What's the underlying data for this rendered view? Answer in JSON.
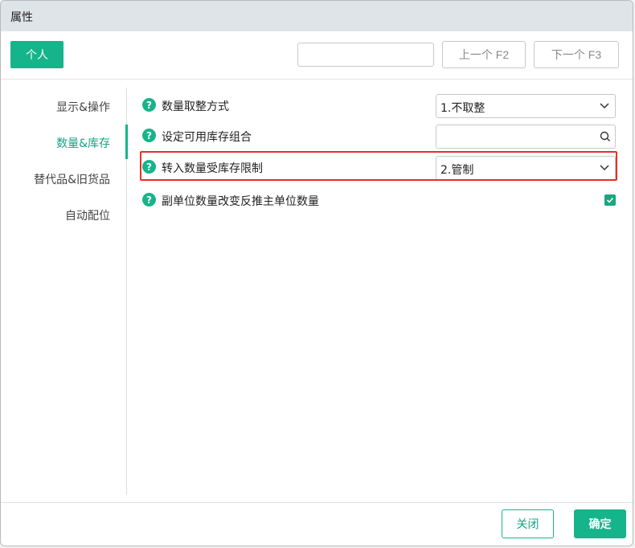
{
  "window": {
    "title": "属性"
  },
  "toolbar": {
    "tab_label": "个人",
    "search": {
      "value": "",
      "placeholder": ""
    },
    "prev_label": "上一个 F2",
    "next_label": "下一个 F3"
  },
  "sidebar": {
    "items": [
      {
        "label": "显示&操作",
        "active": false
      },
      {
        "label": "数量&库存",
        "active": true
      },
      {
        "label": "替代品&旧货品",
        "active": false
      },
      {
        "label": "自动配位",
        "active": false
      }
    ]
  },
  "settings": {
    "rounding": {
      "label": "数量取整方式",
      "value": "1.不取整"
    },
    "stock_combo": {
      "label": "设定可用库存组合",
      "value": ""
    },
    "transfer_limit": {
      "label": "转入数量受库存限制",
      "value": "2.管制"
    },
    "sub_unit": {
      "label": "副单位数量改变反推主单位数量",
      "checked": true
    }
  },
  "footer": {
    "close_label": "关闭",
    "ok_label": "确定"
  },
  "colors": {
    "accent": "#16b48a",
    "highlight": "#e5302a",
    "titlebar": "#dfe4e8"
  },
  "icons": {
    "help": "help-icon",
    "dropdown": "chevron-down-icon",
    "search": "search-icon",
    "check": "check-icon"
  }
}
